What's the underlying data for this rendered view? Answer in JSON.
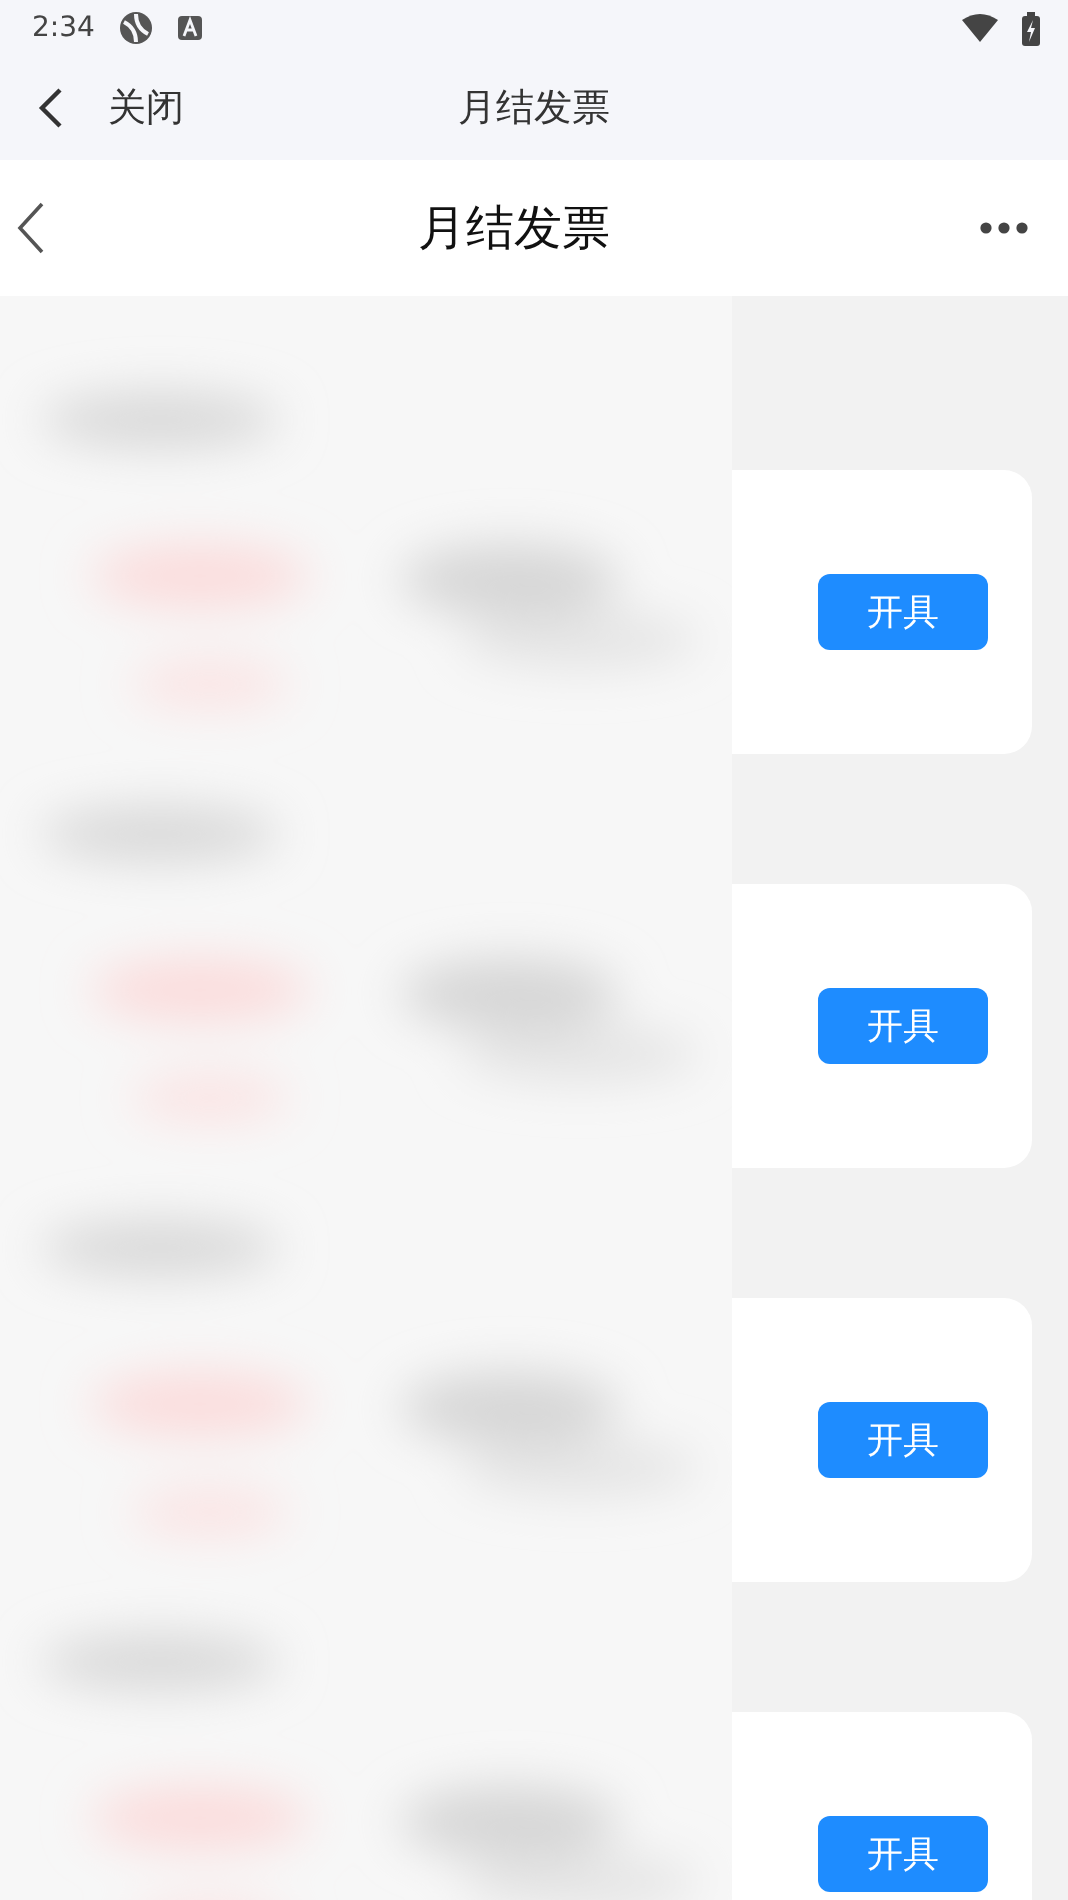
{
  "status_bar": {
    "time": "2:34"
  },
  "webview_bar": {
    "close_label": "关闭",
    "title": "月结发票"
  },
  "header": {
    "title": "月结发票"
  },
  "invoices": [
    {
      "button": "开具"
    },
    {
      "button": "开具"
    },
    {
      "button": "开具"
    },
    {
      "button": "开具"
    }
  ]
}
